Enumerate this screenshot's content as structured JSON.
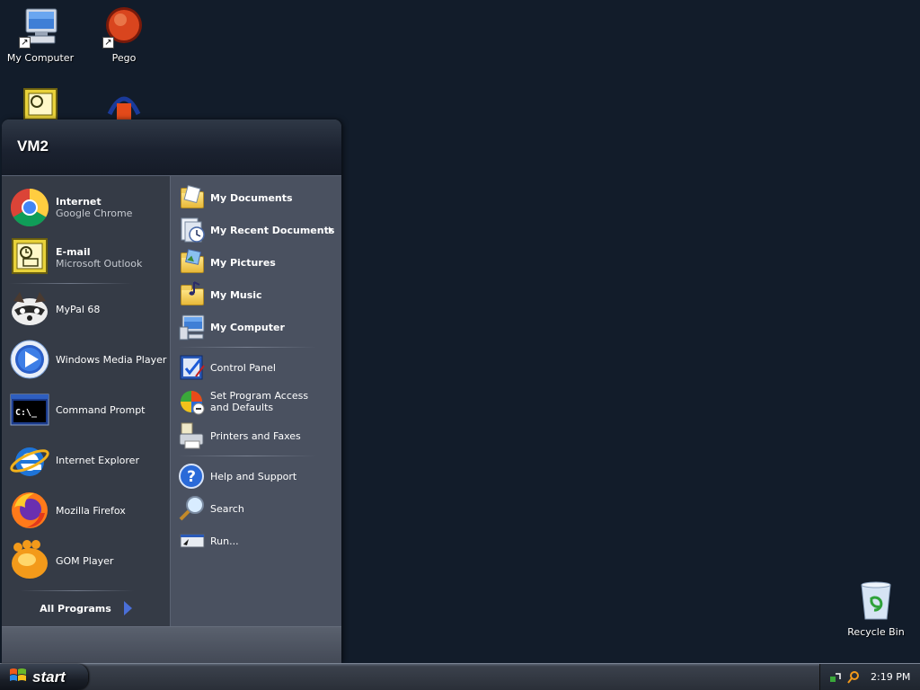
{
  "desktop": {
    "icons": [
      {
        "label": "My Computer"
      },
      {
        "label": "Pego"
      },
      {
        "label": ""
      },
      {
        "label": ""
      }
    ],
    "recycle_bin": {
      "label": "Recycle Bin"
    }
  },
  "start_menu": {
    "user_name": "VM2",
    "pinned": [
      {
        "title": "Internet",
        "subtitle": "Google Chrome",
        "icon": "chrome-icon"
      },
      {
        "title": "E-mail",
        "subtitle": "Microsoft Outlook",
        "icon": "outlook-icon"
      }
    ],
    "recent_programs": [
      {
        "title": "MyPal 68",
        "icon": "mypal-icon"
      },
      {
        "title": "Windows Media Player",
        "icon": "media-player-icon"
      },
      {
        "title": "Command Prompt",
        "icon": "command-prompt-icon"
      },
      {
        "title": "Internet Explorer",
        "icon": "internet-explorer-icon"
      },
      {
        "title": "Mozilla Firefox",
        "icon": "firefox-icon"
      },
      {
        "title": "GOM Player",
        "icon": "gom-player-icon"
      }
    ],
    "all_programs_label": "All Programs",
    "places": [
      {
        "title": "My Documents"
      },
      {
        "title": "My Recent Documents"
      },
      {
        "title": "My Pictures"
      },
      {
        "title": "My Music"
      },
      {
        "title": "My Computer"
      }
    ],
    "system": [
      {
        "title": "Control Panel"
      },
      {
        "title": "Set Program Access and Defaults"
      },
      {
        "title": "Printers and Faxes"
      }
    ],
    "tools": [
      {
        "title": "Help and Support"
      },
      {
        "title": "Search"
      },
      {
        "title": "Run..."
      }
    ]
  },
  "taskbar": {
    "start_label": "start",
    "clock": "2:19 PM"
  },
  "colors": {
    "desktop_bg": "#121c2a",
    "menu_left_bg": "#353b46",
    "menu_right_bg": "#4a5160",
    "all_programs_arrow": "#4a6fd8"
  }
}
